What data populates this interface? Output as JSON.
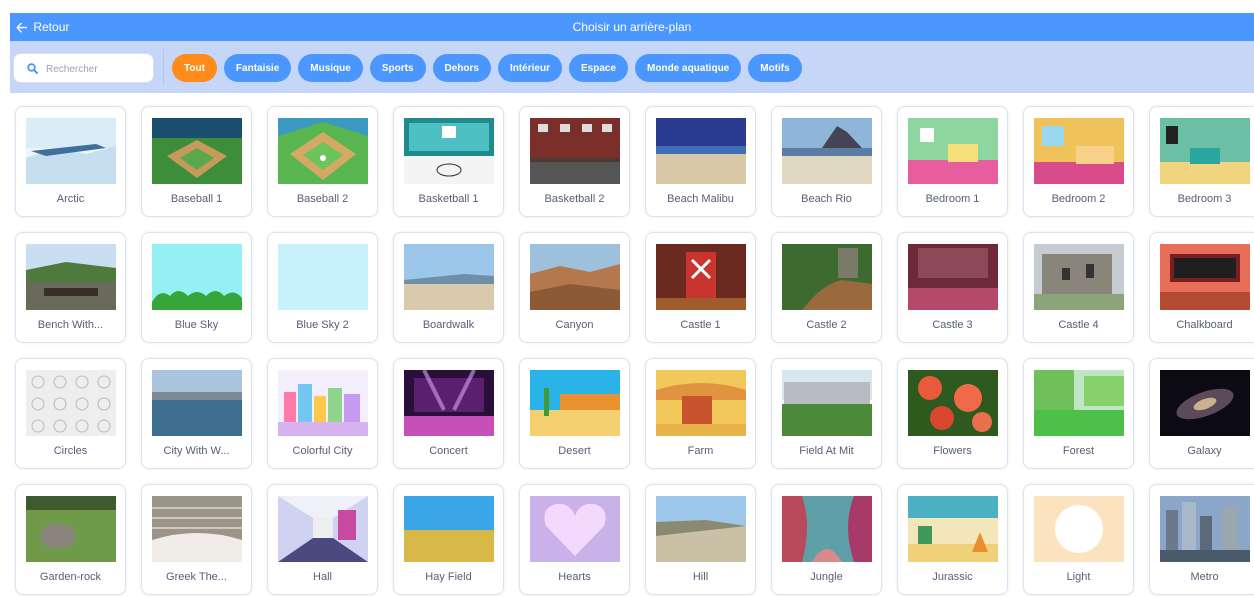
{
  "header": {
    "back_label": "Retour",
    "title": "Choisir un arrière-plan"
  },
  "search": {
    "placeholder": "Rechercher",
    "value": ""
  },
  "tags": [
    {
      "label": "Tout",
      "active": true
    },
    {
      "label": "Fantaisie",
      "active": false
    },
    {
      "label": "Musique",
      "active": false
    },
    {
      "label": "Sports",
      "active": false
    },
    {
      "label": "Dehors",
      "active": false
    },
    {
      "label": "Intérieur",
      "active": false
    },
    {
      "label": "Espace",
      "active": false
    },
    {
      "label": "Monde aquatique",
      "active": false
    },
    {
      "label": "Motifs",
      "active": false
    }
  ],
  "backdrops": [
    {
      "name": "Arctic",
      "thumb": "arctic"
    },
    {
      "name": "Baseball 1",
      "thumb": "baseball1"
    },
    {
      "name": "Baseball 2",
      "thumb": "baseball2"
    },
    {
      "name": "Basketball 1",
      "thumb": "basketball1"
    },
    {
      "name": "Basketball 2",
      "thumb": "basketball2"
    },
    {
      "name": "Beach Malibu",
      "thumb": "beach-malibu"
    },
    {
      "name": "Beach Rio",
      "thumb": "beach-rio"
    },
    {
      "name": "Bedroom 1",
      "thumb": "bedroom1"
    },
    {
      "name": "Bedroom 2",
      "thumb": "bedroom2"
    },
    {
      "name": "Bedroom 3",
      "thumb": "bedroom3"
    },
    {
      "name": "Bench With...",
      "thumb": "bench"
    },
    {
      "name": "Blue Sky",
      "thumb": "blue-sky"
    },
    {
      "name": "Blue Sky 2",
      "thumb": "blue-sky2"
    },
    {
      "name": "Boardwalk",
      "thumb": "boardwalk"
    },
    {
      "name": "Canyon",
      "thumb": "canyon"
    },
    {
      "name": "Castle 1",
      "thumb": "castle1"
    },
    {
      "name": "Castle 2",
      "thumb": "castle2"
    },
    {
      "name": "Castle 3",
      "thumb": "castle3"
    },
    {
      "name": "Castle 4",
      "thumb": "castle4"
    },
    {
      "name": "Chalkboard",
      "thumb": "chalkboard"
    },
    {
      "name": "Circles",
      "thumb": "circles"
    },
    {
      "name": "City With W...",
      "thumb": "city-water"
    },
    {
      "name": "Colorful City",
      "thumb": "colorful-city"
    },
    {
      "name": "Concert",
      "thumb": "concert"
    },
    {
      "name": "Desert",
      "thumb": "desert"
    },
    {
      "name": "Farm",
      "thumb": "farm"
    },
    {
      "name": "Field At Mit",
      "thumb": "field-mit"
    },
    {
      "name": "Flowers",
      "thumb": "flowers"
    },
    {
      "name": "Forest",
      "thumb": "forest"
    },
    {
      "name": "Galaxy",
      "thumb": "galaxy"
    },
    {
      "name": "Garden-rock",
      "thumb": "garden-rock"
    },
    {
      "name": "Greek The...",
      "thumb": "greek-theater"
    },
    {
      "name": "Hall",
      "thumb": "hall"
    },
    {
      "name": "Hay Field",
      "thumb": "hay-field"
    },
    {
      "name": "Hearts",
      "thumb": "hearts"
    },
    {
      "name": "Hill",
      "thumb": "hill"
    },
    {
      "name": "Jungle",
      "thumb": "jungle"
    },
    {
      "name": "Jurassic",
      "thumb": "jurassic"
    },
    {
      "name": "Light",
      "thumb": "light"
    },
    {
      "name": "Metro",
      "thumb": "metro"
    }
  ],
  "colors": {
    "header_bg": "#4c97ff",
    "filter_bg": "#c5d6f9",
    "tag_bg": "#4c97ff",
    "tag_active_bg": "#ff8c1a",
    "label_text": "#575e75"
  }
}
